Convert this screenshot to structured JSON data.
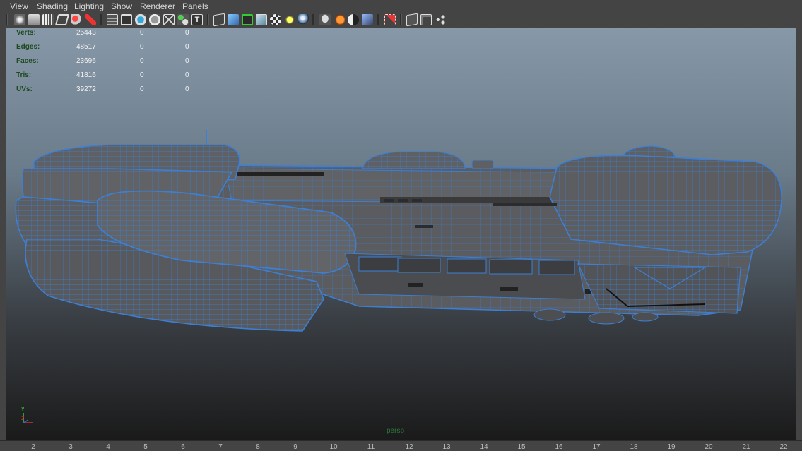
{
  "menu": [
    "View",
    "Shading",
    "Lighting",
    "Show",
    "Renderer",
    "Panels"
  ],
  "toolbar": {
    "icons": [
      "select-camera-icon",
      "camera-attributes-icon",
      "bookmark-icon",
      "image-plane-icon",
      "2d-pan-zoom-icon",
      "grease-pencil-icon",
      "grid-icon",
      "film-gate-icon",
      "resolution-gate-icon",
      "gate-mask-icon",
      "field-chart-icon",
      "safe-title-icon",
      "wireframe-icon",
      "smooth-shade-icon",
      "wireframe-on-shaded-icon",
      "default-material-icon",
      "textured-icon",
      "use-all-lights-icon",
      "shadows-icon",
      "screen-space-ao-icon",
      "motion-blur-icon",
      "anti-aliasing-icon",
      "depth-of-field-icon",
      "isolate-select-icon",
      "xray-icon",
      "xray-joints-icon",
      "xray-components-icon"
    ]
  },
  "hud": {
    "rows": [
      {
        "label": "Verts:",
        "v1": "25443",
        "v2": "0",
        "v3": "0"
      },
      {
        "label": "Edges:",
        "v1": "48517",
        "v2": "0",
        "v3": "0"
      },
      {
        "label": "Faces:",
        "v1": "23696",
        "v2": "0",
        "v3": "0"
      },
      {
        "label": "Tris:",
        "v1": "41816",
        "v2": "0",
        "v3": "0"
      },
      {
        "label": "UVs:",
        "v1": "39272",
        "v2": "0",
        "v3": "0"
      }
    ]
  },
  "axis": {
    "y": "y",
    "z": "z"
  },
  "camera_label": "persp",
  "ruler": [
    "2",
    "3",
    "4",
    "5",
    "6",
    "7",
    "8",
    "9",
    "10",
    "11",
    "12",
    "13",
    "14",
    "15",
    "16",
    "17",
    "18",
    "19",
    "20",
    "21",
    "22"
  ],
  "colors": {
    "wire": "#3d7fd4",
    "mesh": "#55575a",
    "menu_text": "#d6d6d6",
    "hud_label": "#1f4a1f"
  }
}
